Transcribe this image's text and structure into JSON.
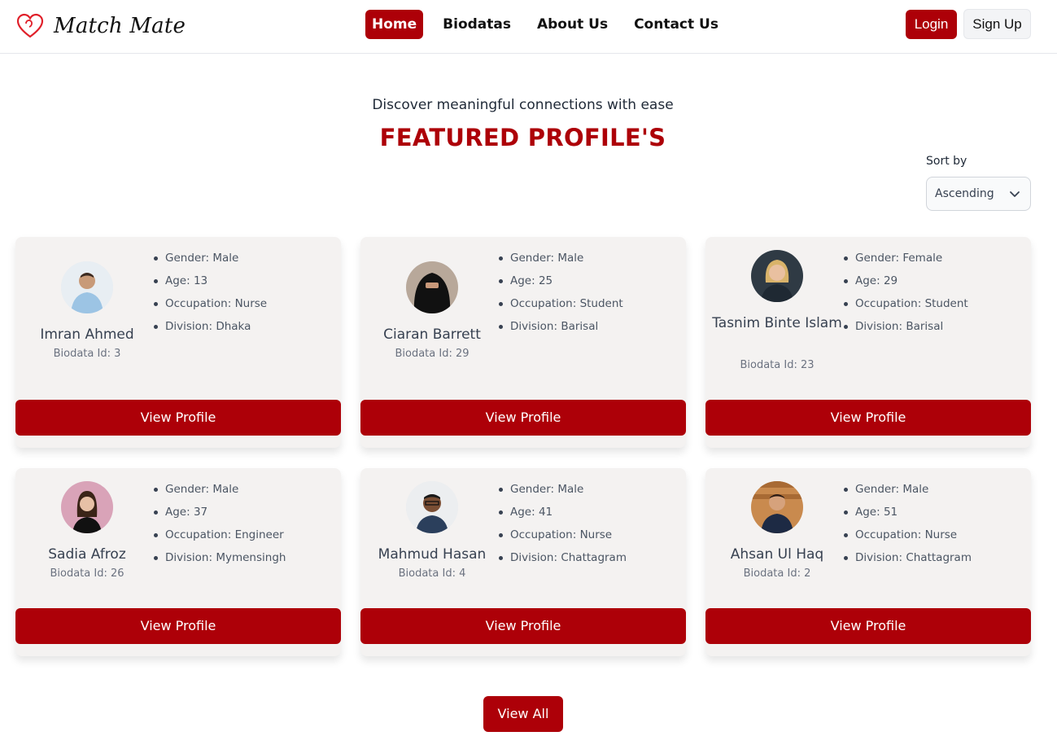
{
  "brand": {
    "name": "Match Mate",
    "logo_icon": "heart-logo-icon",
    "accent": "#ad0008"
  },
  "nav": {
    "links": [
      {
        "label": "Home",
        "active": true
      },
      {
        "label": "Biodatas",
        "active": false
      },
      {
        "label": "About Us",
        "active": false
      },
      {
        "label": "Contact Us",
        "active": false
      }
    ],
    "login_label": "Login",
    "signup_label": "Sign Up"
  },
  "hero": {
    "subtitle": "Discover meaningful connections with ease",
    "title": "FEATURED PROFILE'S"
  },
  "sort": {
    "label": "Sort by",
    "selected": "Ascending"
  },
  "profiles": [
    {
      "name": "Imran Ahmed",
      "biodata": "Biodata Id: 3",
      "gender": "Gender: Male",
      "age": "Age: 13",
      "occupation": "Occupation: Nurse",
      "division": "Division: Dhaka",
      "button": "View Profile"
    },
    {
      "name": "Ciaran Barrett",
      "biodata": "Biodata Id: 29",
      "gender": "Gender: Male",
      "age": "Age: 25",
      "occupation": "Occupation: Student",
      "division": "Division: Barisal",
      "button": "View Profile"
    },
    {
      "name": "Tasnim Binte Islam",
      "biodata": "Biodata Id: 23",
      "gender": "Gender: Female",
      "age": "Age: 29",
      "occupation": "Occupation: Student",
      "division": "Division: Barisal",
      "button": "View Profile"
    },
    {
      "name": "Sadia Afroz",
      "biodata": "Biodata Id: 26",
      "gender": "Gender: Male",
      "age": "Age: 37",
      "occupation": "Occupation: Engineer",
      "division": "Division: Mymensingh",
      "button": "View Profile"
    },
    {
      "name": "Mahmud Hasan",
      "biodata": "Biodata Id: 4",
      "gender": "Gender: Male",
      "age": "Age: 41",
      "occupation": "Occupation: Nurse",
      "division": "Division: Chattagram",
      "button": "View Profile"
    },
    {
      "name": "Ahsan Ul Haq",
      "biodata": "Biodata Id: 2",
      "gender": "Gender: Male",
      "age": "Age: 51",
      "occupation": "Occupation: Nurse",
      "division": "Division: Chattagram",
      "button": "View Profile"
    }
  ],
  "view_all_label": "View All"
}
